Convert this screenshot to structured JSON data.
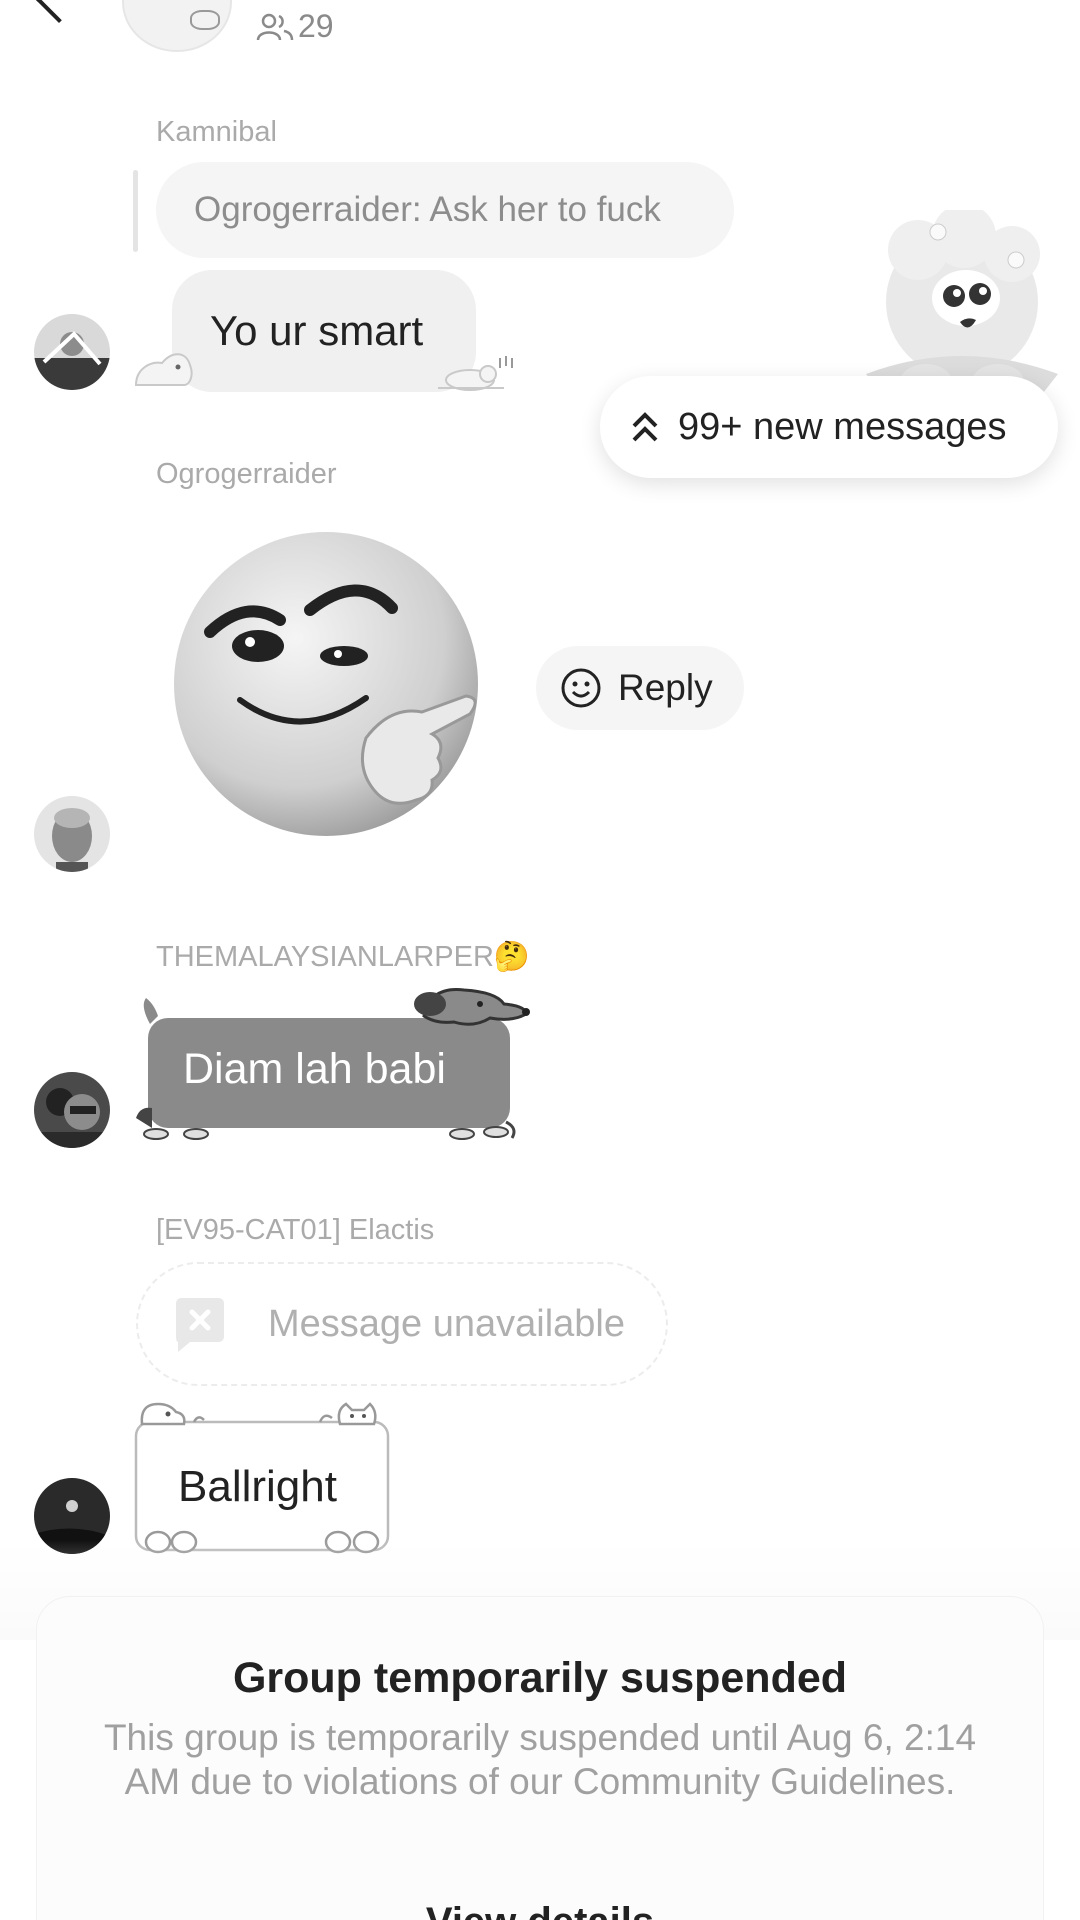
{
  "header": {
    "member_count": "29",
    "icons": [
      "back-arrow-icon",
      "group-avatar",
      "members-icon",
      "more-icon"
    ]
  },
  "messages": [
    {
      "sender": "Kamnibal",
      "quote": "Ogrogerraider: Ask her to fuck",
      "text": "Yo ur smart"
    },
    {
      "sender": "Ogrogerraider",
      "sticker": "smirking-face-sticker",
      "reply_label": "Reply"
    },
    {
      "sender": "THEMALAYSIANLARPER🤔",
      "text": "Diam lah babi"
    },
    {
      "sender": "[EV95-CAT01] Elactis",
      "text": "Message unavailable"
    },
    {
      "text": "Ballright"
    }
  ],
  "new_messages_label": "99+ new messages",
  "suspension": {
    "title": "Group temporarily suspended",
    "body": "This group is temporarily suspended until Aug 6, 2:14 AM due to violations of our Community Guidelines.",
    "link": "View details"
  },
  "colors": {
    "background": "#ffffff",
    "bubble": "#f0f0f0",
    "themed_bubble": "#8a8a8a",
    "muted_text": "#aaaaaa"
  }
}
